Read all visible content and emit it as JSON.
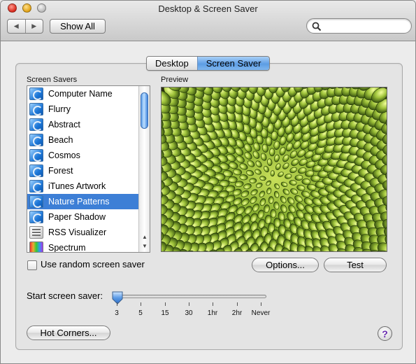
{
  "window": {
    "title": "Desktop & Screen Saver"
  },
  "toolbar": {
    "back_icon": "back-arrow-icon",
    "forward_icon": "forward-arrow-icon",
    "show_all_label": "Show All",
    "search_placeholder": "",
    "search_icon": "magnifier-icon"
  },
  "tabs": [
    {
      "label": "Desktop",
      "selected": false
    },
    {
      "label": "Screen Saver",
      "selected": true
    }
  ],
  "screen_savers": {
    "label": "Screen Savers",
    "items": [
      {
        "label": "Computer Name",
        "icon": "swirl-icon"
      },
      {
        "label": "Flurry",
        "icon": "swirl-icon"
      },
      {
        "label": "Abstract",
        "icon": "swirl-icon"
      },
      {
        "label": "Beach",
        "icon": "swirl-icon"
      },
      {
        "label": "Cosmos",
        "icon": "swirl-icon"
      },
      {
        "label": "Forest",
        "icon": "swirl-icon"
      },
      {
        "label": "iTunes Artwork",
        "icon": "swirl-icon"
      },
      {
        "label": "Nature Patterns",
        "icon": "swirl-icon",
        "selected": true
      },
      {
        "label": "Paper Shadow",
        "icon": "swirl-icon"
      },
      {
        "label": "RSS Visualizer",
        "icon": "rss-icon"
      },
      {
        "label": "Spectrum",
        "icon": "spectrum-icon"
      }
    ]
  },
  "preview": {
    "label": "Preview",
    "image": "sunflower-head-closeup"
  },
  "random": {
    "label": "Use random screen saver",
    "checked": false
  },
  "buttons": {
    "options": "Options...",
    "test": "Test",
    "hot_corners": "Hot Corners...",
    "help": "?"
  },
  "start": {
    "label": "Start screen saver:",
    "ticks": [
      "3",
      "5",
      "15",
      "30",
      "1hr",
      "2hr",
      "Never"
    ],
    "selected_index": 0
  },
  "colors": {
    "selection": "#3d7fd6",
    "tab_active": "#6aa8ea",
    "help_glyph": "#6a2bb0"
  }
}
